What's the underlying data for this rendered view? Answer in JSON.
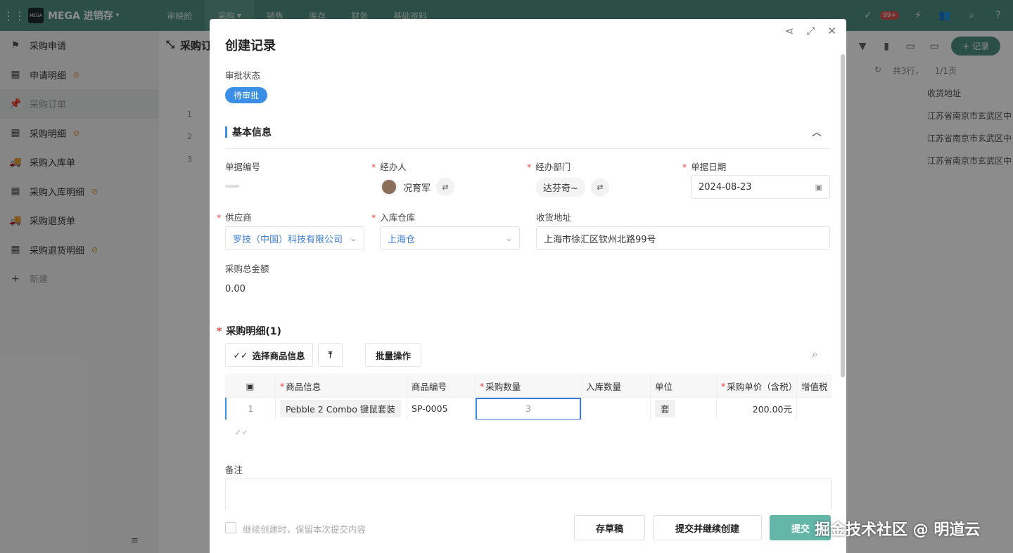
{
  "topbar": {
    "app_title": "MEGA 进销存",
    "nav": [
      "审映舱",
      "采购",
      "销售",
      "库存",
      "财务",
      "基础资料"
    ],
    "badge": "99+"
  },
  "sidebar": {
    "items": [
      {
        "label": "采购申请",
        "icon": "flag-icon",
        "hidden": false
      },
      {
        "label": "申请明细",
        "icon": "table-icon",
        "hidden": true
      },
      {
        "label": "采购订单",
        "icon": "pin-icon",
        "hidden": false
      },
      {
        "label": "采购明细",
        "icon": "table-icon",
        "hidden": true
      },
      {
        "label": "采购入库单",
        "icon": "truck-icon",
        "hidden": false
      },
      {
        "label": "采购入库明细",
        "icon": "table-icon",
        "hidden": true
      },
      {
        "label": "采购退货单",
        "icon": "truck-icon",
        "hidden": false
      },
      {
        "label": "采购退货明细",
        "icon": "table-icon",
        "hidden": true
      },
      {
        "label": "新建",
        "icon": "plus-icon",
        "hidden": false
      }
    ]
  },
  "background": {
    "page_title": "采购订",
    "add_record": "+ 记录",
    "count_text": "共3行，",
    "page_text": "1/1页",
    "addr_header": "收货地址",
    "rows": [
      {
        "num": "1",
        "addr": "江苏省南京市玄武区中"
      },
      {
        "num": "2",
        "addr": "江苏省南京市玄武区中"
      },
      {
        "num": "3",
        "addr": "江苏省南京市玄武区中"
      }
    ]
  },
  "modal": {
    "title": "创建记录",
    "approval_label": "审批状态",
    "approval_value": "待审批",
    "section_title": "基本信息",
    "fields": {
      "doc_no_label": "单据编号",
      "handler_label": "经办人",
      "handler_value": "况育军",
      "dept_label": "经办部门",
      "dept_value": "达芬奇~",
      "date_label": "单据日期",
      "date_value": "2024-08-23",
      "supplier_label": "供应商",
      "supplier_value": "罗技（中国）科技有限公司",
      "warehouse_label": "入库仓库",
      "warehouse_value": "上海仓",
      "address_label": "收货地址",
      "address_value": "上海市徐汇区钦州北路99号",
      "total_label": "采购总金额",
      "total_value": "0.00"
    },
    "detail": {
      "title": "采购明细(1)",
      "btn_select": "选择商品信息",
      "btn_batch": "批量操作",
      "columns": [
        "商品信息",
        "商品编号",
        "采购数量",
        "入库数量",
        "单位",
        "采购单价（含税）",
        "增值税"
      ],
      "row": {
        "index": "1",
        "product": "Pebble 2 Combo 键鼠套装",
        "code": "SP-0005",
        "qty": "3",
        "in_qty": "",
        "unit": "套",
        "price": "200.00元"
      }
    },
    "remark_label": "备注",
    "keep_label": "继续创建时，保留本次提交内容",
    "btn_draft": "存草稿",
    "btn_submit_continue": "提交并继续创建",
    "btn_submit": "提交"
  },
  "watermark": "掘金技术社区 @ 明道云"
}
